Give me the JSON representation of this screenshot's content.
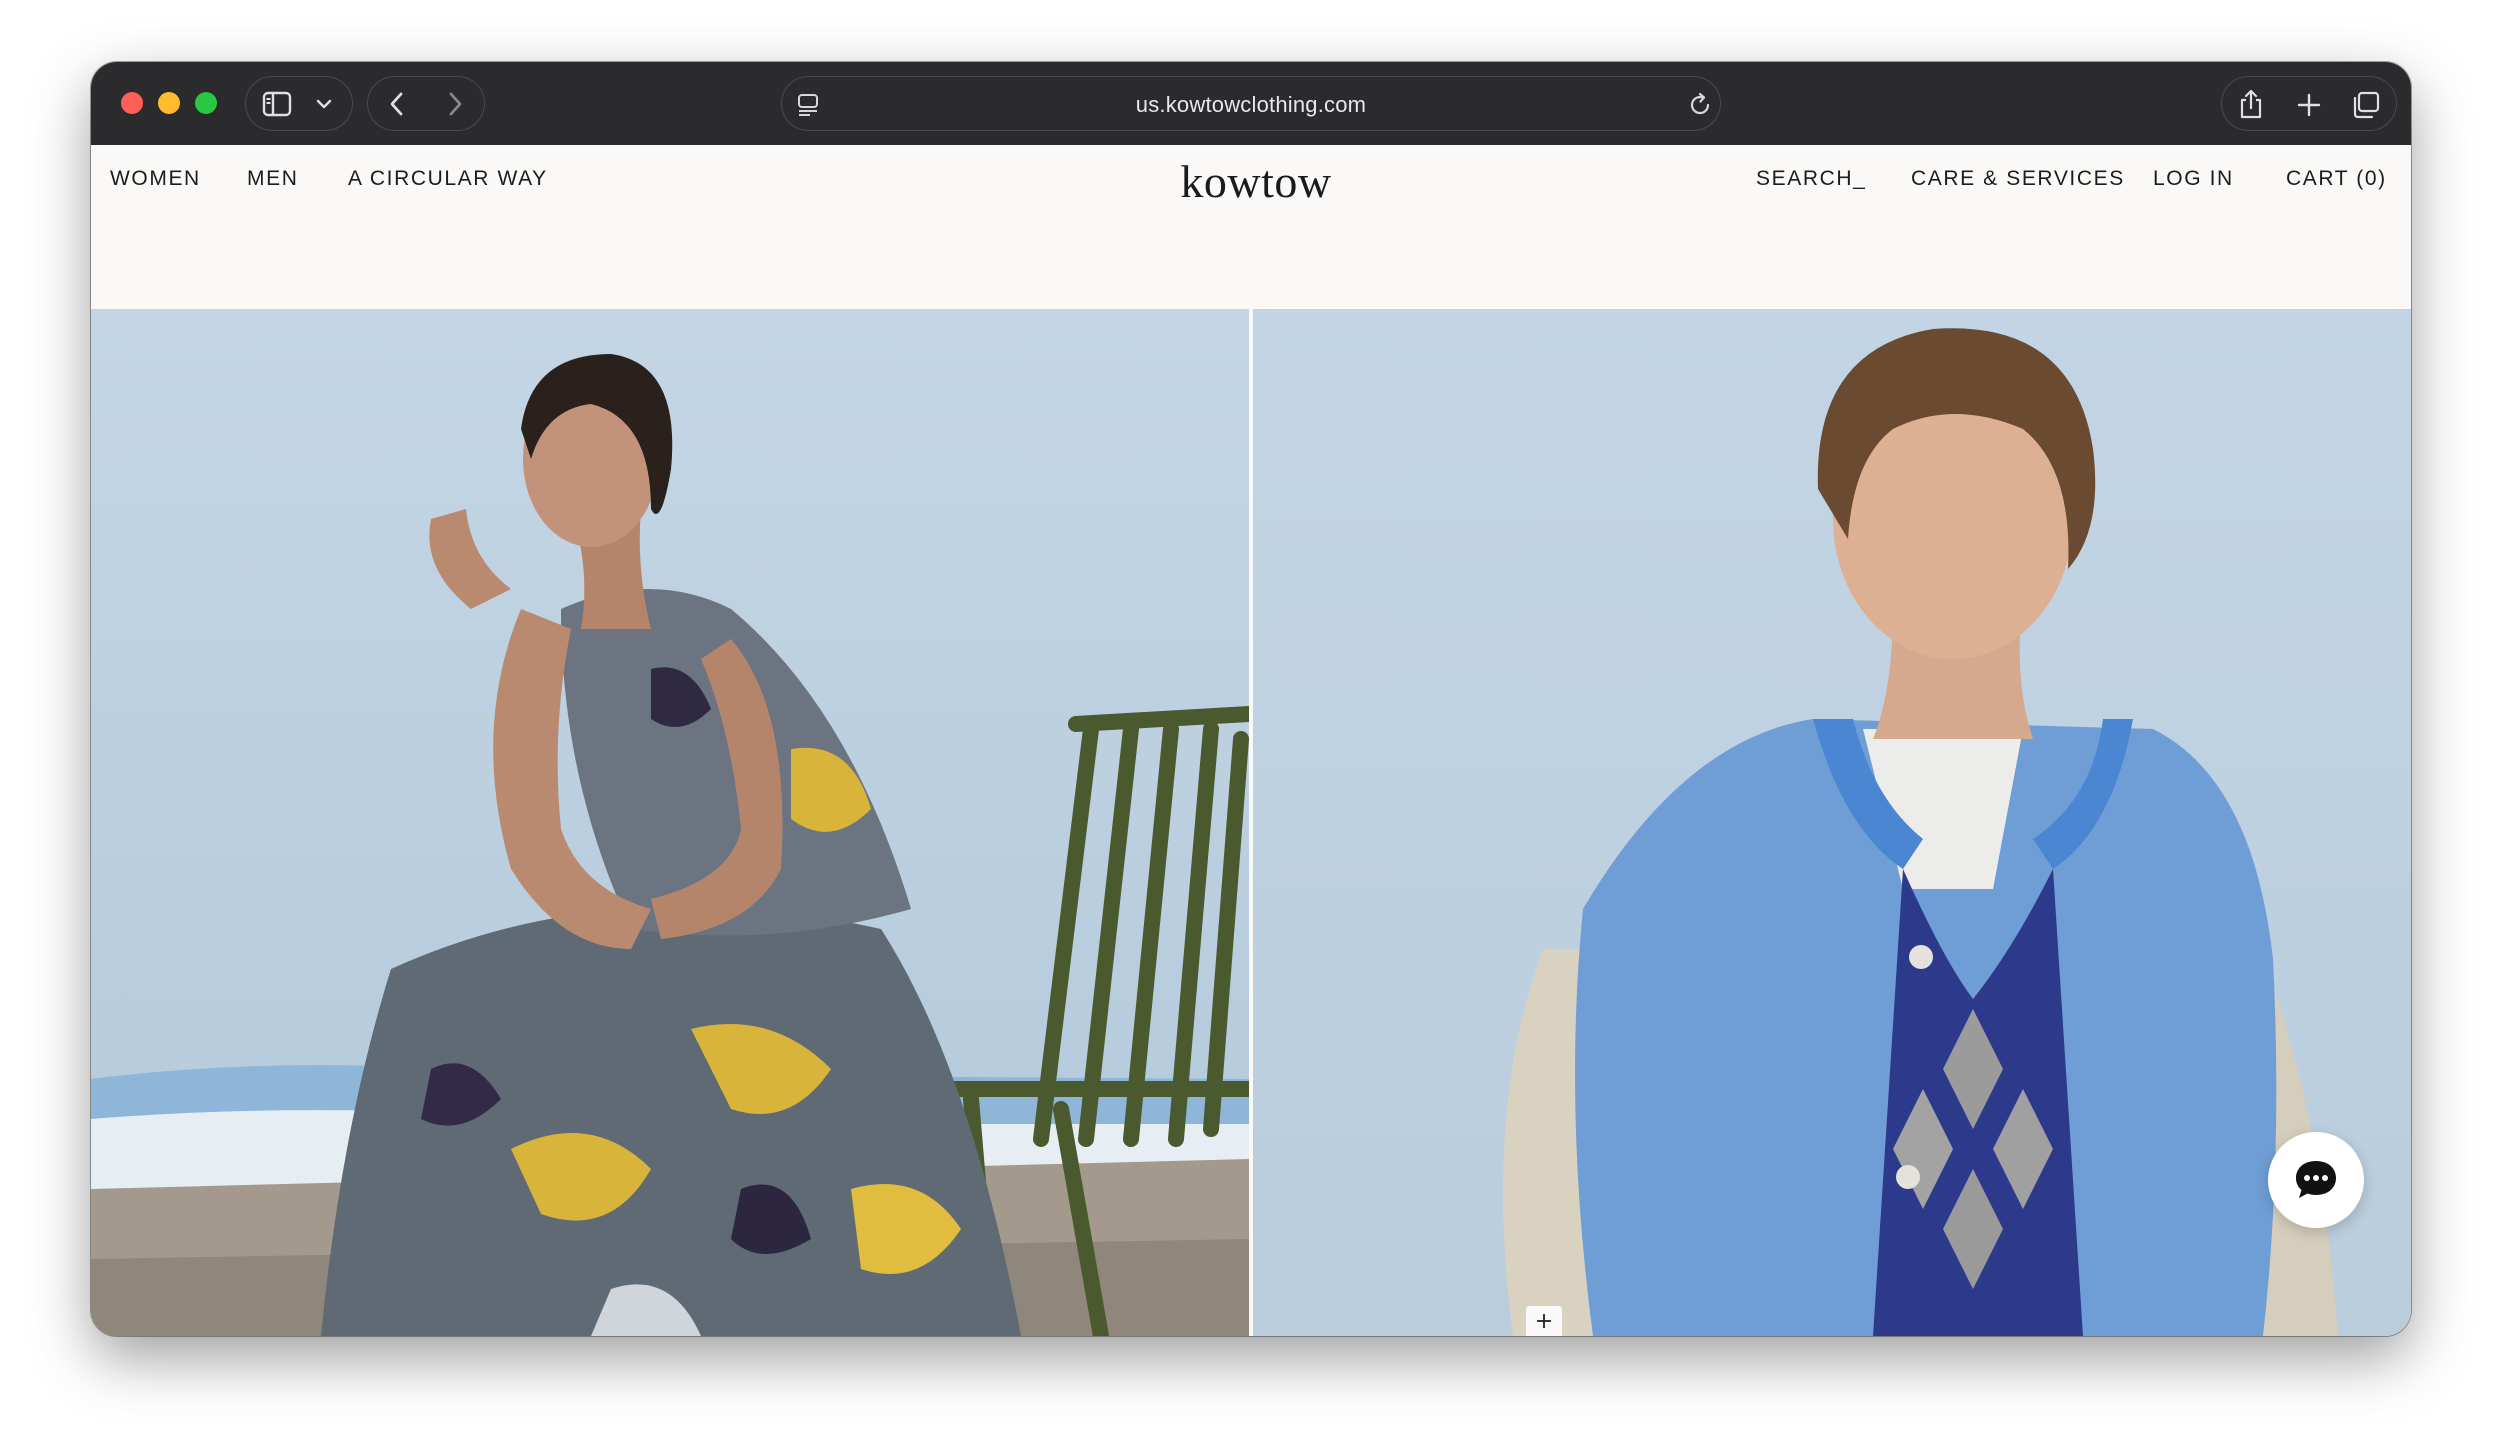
{
  "browser": {
    "url": "us.kowtowclothing.com"
  },
  "site": {
    "logo": "kowtow",
    "nav_left": [
      "WOMEN",
      "MEN",
      "A CIRCULAR WAY"
    ],
    "nav_right": [
      "SEARCH_",
      "CARE & SERVICES",
      "LOG IN",
      "CART (0)"
    ]
  },
  "hero": {
    "left_image": "woman-in-floral-dress-seated-on-green-chair",
    "right_image": "man-in-blue-varsity-jacket"
  },
  "icons": {
    "plus": "plus-icon",
    "chat": "chat-bubble-icon"
  },
  "colors": {
    "chrome": "#2b2b2d",
    "page_bg": "#faf9f7",
    "sky_blue": "#bcd0e0",
    "jacket_blue": "#6f9ed6"
  }
}
